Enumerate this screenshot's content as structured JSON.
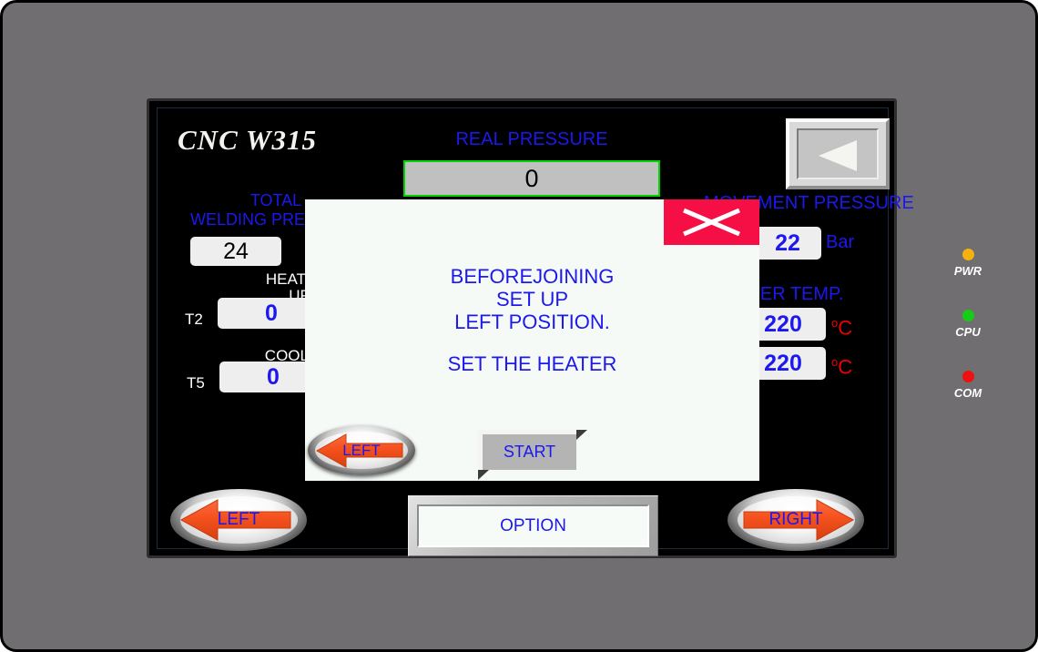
{
  "device": {
    "brand_title": "CNC W315"
  },
  "header": {
    "real_pressure_label": "REAL PRESSURE",
    "real_pressure_value": "0",
    "back_button_name": "back-button"
  },
  "left_panel": {
    "total_welding_pressure_label_line1": "TOTAL",
    "total_welding_pressure_label_line2": "WELDING PRESSURE",
    "total_welding_pressure_value": "24",
    "heating_up_label_line1": "HEATING",
    "heating_up_label_line2": "UP",
    "heating_up_tag": "T2",
    "heating_up_value": "0",
    "cooling_label": "COOLING",
    "cooling_tag": "T5",
    "cooling_value": "0"
  },
  "right_panel": {
    "movement_pressure_label": "MOVEMENT PRESSURE",
    "movement_pressure_value": "22",
    "movement_pressure_unit": "Bar",
    "heater_temp_label": "HEATER TEMP.",
    "heater_temp_value_1": "220",
    "heater_temp_value_2": "220",
    "temp_unit": "C",
    "temp_unit_degree": "o"
  },
  "modal": {
    "line1": "BEFOREJOINING",
    "line2": "SET UP",
    "line3": "LEFT POSITION.",
    "line4": "SET THE HEATER",
    "close_label": "close-x",
    "left_button_label": "LEFT",
    "start_button_label": "START"
  },
  "footer": {
    "left_button_label": "LEFT",
    "option_button_label": "OPTION",
    "right_button_label": "RIGHT"
  },
  "status_leds": [
    {
      "label": "PWR",
      "color": "#f3b20c"
    },
    {
      "label": "CPU",
      "color": "#17cc17"
    },
    {
      "label": "COM",
      "color": "#ee1111"
    }
  ],
  "colors": {
    "bezel": "#706e70",
    "screen_bg": "#000000",
    "accent_blue": "#1c18ee",
    "accent_red": "#ee0000",
    "close_red": "#f50f45",
    "green_border": "#00d400",
    "arrow_orange": "#f4511e"
  }
}
